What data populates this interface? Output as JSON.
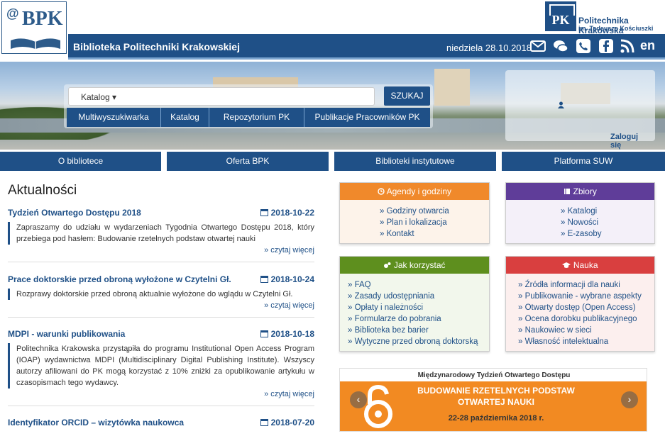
{
  "header": {
    "logo_text": "BPK",
    "logo_at": "@",
    "pk_logo_text": "PK",
    "pk_name": "Politechnika Krakowska",
    "pk_sub": "im. Tadeusza Kościuszki",
    "site_title": "Biblioteka Politechniki Krakowskiej",
    "date": "niedziela 28.10.2018",
    "lang": "en",
    "icons": [
      "mail-icon",
      "chat-icon",
      "phone-icon",
      "facebook-icon",
      "rss-icon"
    ]
  },
  "search": {
    "select_value": "Katalog",
    "button": "SZUKAJ",
    "tabs": [
      "Multiwyszukiwarka",
      "Katalog",
      "Repozytorium PK",
      "Publikacje Pracowników PK"
    ],
    "login": "Zaloguj się"
  },
  "nav": [
    "O bibliotece",
    "Oferta BPK",
    "Biblioteki instytutowe",
    "Platforma SUW"
  ],
  "news": {
    "heading": "Aktualności",
    "more": "» czytaj więcej",
    "items": [
      {
        "title": "Tydzień Otwartego Dostępu 2018",
        "date": "2018-10-22",
        "body": "Zapraszamy do udziału w wydarzeniach Tygodnia Otwartego Dostępu 2018, który przebiega pod hasłem: Budowanie rzetelnych podstaw otwartej nauki"
      },
      {
        "title": "Prace doktorskie przed obroną wyłożone w Czytelni Gł.",
        "date": "2018-10-24",
        "body": "Rozprawy doktorskie przed obroną aktualnie wyłożone do wglądu w Czytelni Gł."
      },
      {
        "title": "MDPI - warunki publikowania",
        "date": "2018-10-18",
        "body": "Politechnika Krakowska przystąpiła do programu Institutional Open Access Program (IOAP) wydawnictwa MDPI (Multidisciplinary Digital Publishing Institute). Wszyscy autorzy afiliowani do PK mogą korzystać z 10% zniżki za opublikowanie artykułu w czasopismach tego wydawcy."
      },
      {
        "title": "Identyfikator ORCID – wizytówka naukowca",
        "date": "2018-07-20",
        "body": ""
      }
    ]
  },
  "panels": {
    "agendy": {
      "title": "Agendy i godziny",
      "color": "#f0892b",
      "items": [
        "» Godziny otwarcia",
        "» Plan i lokalizacja",
        "» Kontakt"
      ]
    },
    "zbiory": {
      "title": "Zbiory",
      "color": "#5f3d99",
      "items": [
        "» Katalogi",
        "» Nowości",
        "» E-zasoby"
      ]
    },
    "jak": {
      "title": "Jak korzystać",
      "color": "#5e8f1e",
      "items": [
        "» FAQ",
        "» Zasady udostępniania",
        "» Opłaty i należności",
        "» Formularze do pobrania",
        "» Biblioteka bez barier",
        "» Wytyczne przed obroną doktorską"
      ]
    },
    "nauka": {
      "title": "Nauka",
      "color": "#d93f3f",
      "items": [
        "» Źródła informacji dla nauki",
        "» Publikowanie - wybrane aspekty",
        "» Otwarty dostęp (Open Access)",
        "» Ocena dorobku publikacyjnego",
        "» Naukowiec w sieci",
        "» Własność intelektualna"
      ]
    }
  },
  "banner": {
    "top": "Międzynarodowy Tydzień Otwartego Dostępu",
    "line1": "BUDOWANIE RZETELNYCH PODSTAW",
    "line2": "OTWARTEJ NAUKI",
    "dates": "22-28 października 2018 r."
  }
}
